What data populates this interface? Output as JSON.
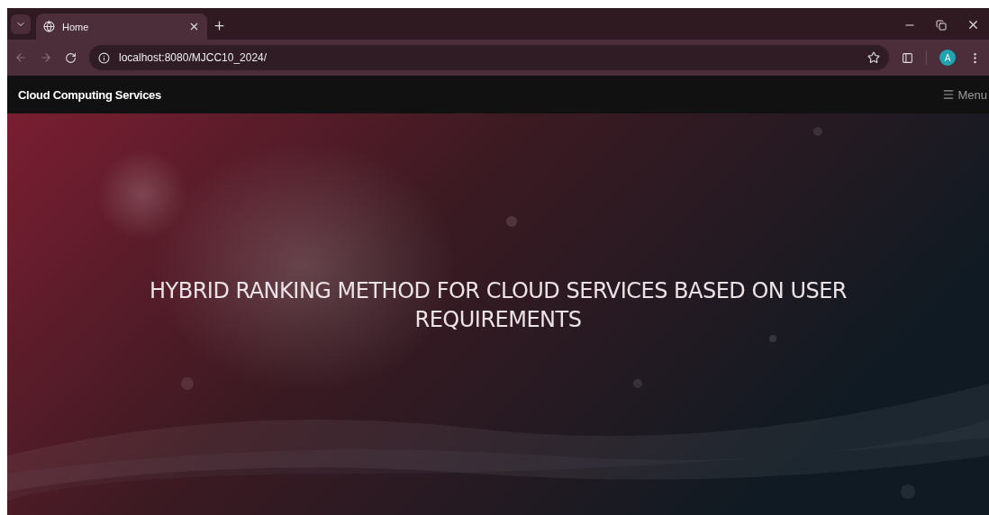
{
  "browser": {
    "tabs": [
      {
        "title": "Home",
        "selected": true
      }
    ],
    "address": "localhost:8080/MJCC10_2024/",
    "profile_initial": "A"
  },
  "navbar": {
    "brand": "Cloud Computing Services",
    "menu": "Menu"
  },
  "hero": {
    "kind": "picture",
    "title": "HYBRID RANKING METHOD FOR CLOUD SERVICES BASED ON USER REQUIREMENTS"
  }
}
